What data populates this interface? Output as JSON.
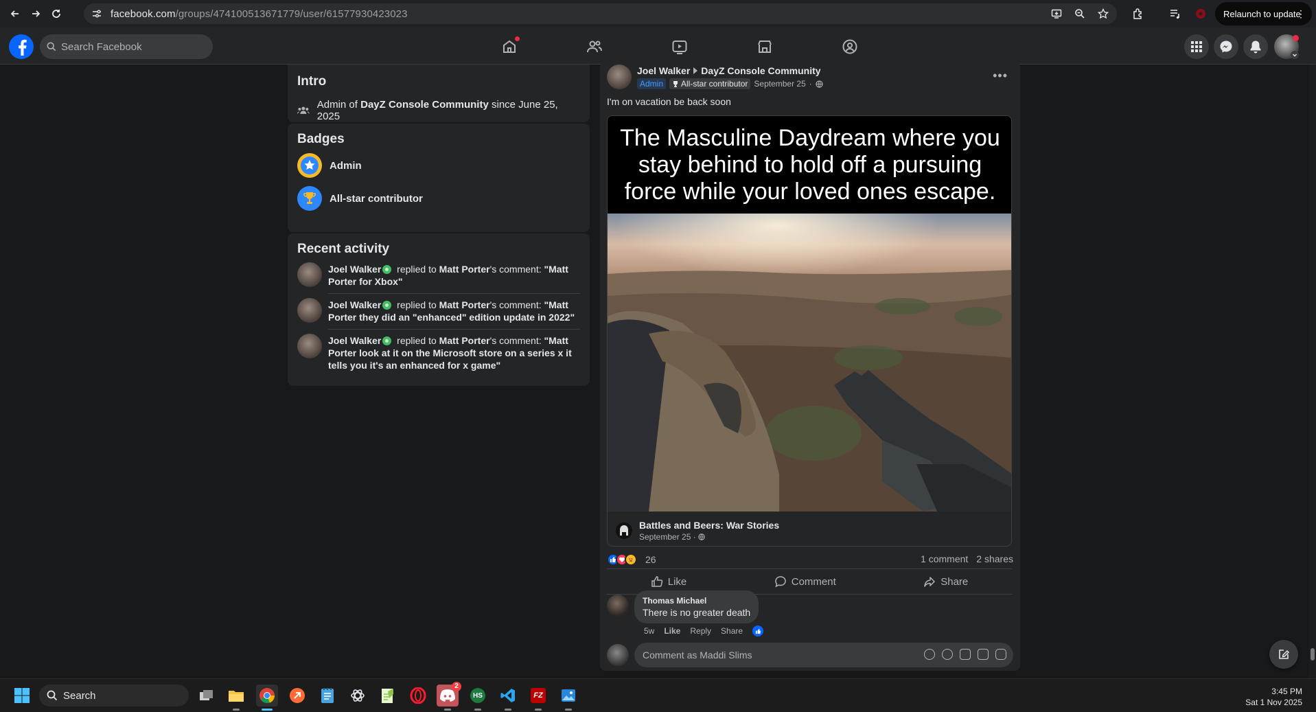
{
  "browser": {
    "url_domain": "facebook.com",
    "url_path": "/groups/474100513671779/user/61577930423023",
    "relaunch_label": "Relaunch to update",
    "menu_glyph": "⋮"
  },
  "fb": {
    "search_placeholder": "Search Facebook",
    "logo_letter": "f"
  },
  "intro": {
    "title": "Intro",
    "prefix": "Admin of ",
    "group": "DayZ Console Community",
    "suffix": " since June 25, 2025"
  },
  "badges": {
    "title": "Badges",
    "items": [
      {
        "label": "Admin",
        "icon": "star-badge-icon"
      },
      {
        "label": "All-star contributor",
        "icon": "trophy-badge-icon"
      }
    ]
  },
  "recent": {
    "title": "Recent activity",
    "items": [
      {
        "user": "Joel Walker",
        "verb": " replied to ",
        "target": "Matt Porter",
        "mid": "'s comment: ",
        "quote": "\"Matt Porter for Xbox\""
      },
      {
        "user": "Joel Walker",
        "verb": " replied to ",
        "target": "Matt Porter",
        "mid": "'s comment: ",
        "quote": "\"Matt Porter they did an \"enhanced\" edition update in 2022\""
      },
      {
        "user": "Joel Walker",
        "verb": " replied to ",
        "target": "Matt Porter",
        "mid": "'s comment: ",
        "quote": "\"Matt Porter look at it on the Microsoft store on a series x it tells you it's an enhanced for x game\""
      }
    ]
  },
  "post": {
    "author": "Joel Walker",
    "group": "DayZ Console Community",
    "admin_tag": "Admin",
    "star_tag": "All-star contributor",
    "date": "September 25",
    "sep": "·",
    "text": "I'm on vacation be back soon",
    "meme_caption": "The Masculine Daydream where you stay behind to hold off a pursuing force while your loved ones escape.",
    "shared_page": "Battles and Beers: War Stories",
    "shared_date": "September 25",
    "reaction_count": "26",
    "comments_count": "1 comment",
    "shares_count": "2 shares",
    "like_label": "Like",
    "comment_label": "Comment",
    "share_label": "Share"
  },
  "comment": {
    "author": "Thomas Michael",
    "text": "There is no greater death",
    "age": "5w",
    "like": "Like",
    "reply": "Reply",
    "share": "Share",
    "composer_placeholder": "Comment as Maddi Slims"
  },
  "taskbar": {
    "search_label": "Search",
    "time": "3:45 PM",
    "date": "Sat 1 Nov 2025",
    "discord_badge": "2",
    "hs_label": "HS",
    "fz_label": "FZ"
  },
  "colors": {
    "fb_blue": "#0866ff",
    "notification_red": "#f02849",
    "verified_green": "#45bd62",
    "admin_blue": "#4599ff"
  }
}
